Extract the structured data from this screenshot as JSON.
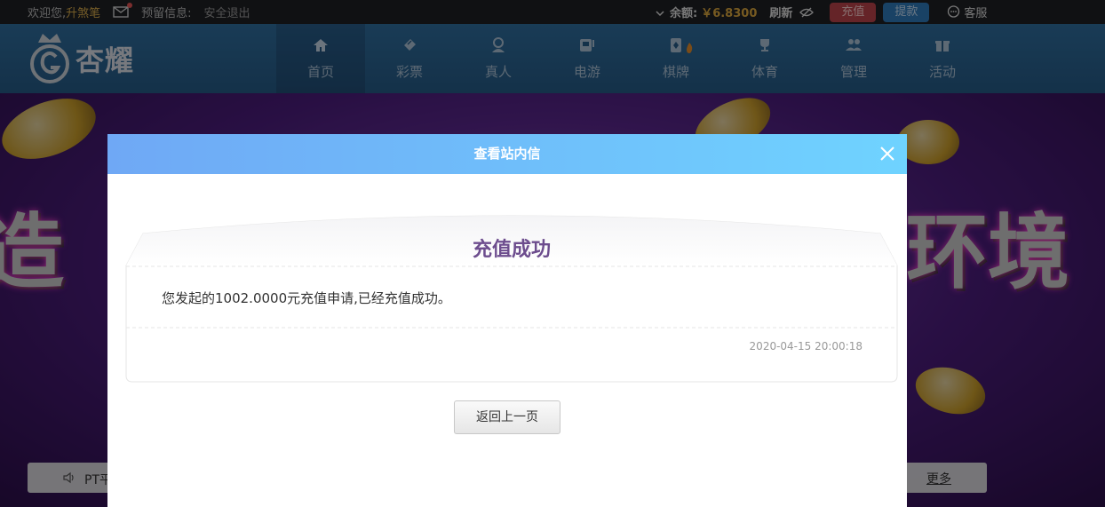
{
  "topbar": {
    "welcome": "欢迎您,",
    "username": "升煞笔",
    "reserve_label": "预留信息:",
    "logout": "安全退出",
    "balance_label": "余额:",
    "balance_value": "￥6.8300",
    "refresh": "刷新",
    "recharge": "充值",
    "withdraw": "提款",
    "service": "客服"
  },
  "logo": {
    "text": "杏耀"
  },
  "nav": {
    "items": [
      {
        "label": "首页",
        "icon": "home-icon"
      },
      {
        "label": "彩票",
        "icon": "lottery-icon"
      },
      {
        "label": "真人",
        "icon": "live-icon"
      },
      {
        "label": "电游",
        "icon": "slot-icon"
      },
      {
        "label": "棋牌",
        "icon": "chess-card-icon"
      },
      {
        "label": "体育",
        "icon": "trophy-icon"
      },
      {
        "label": "管理",
        "icon": "users-icon"
      },
      {
        "label": "活动",
        "icon": "gift-icon"
      }
    ]
  },
  "banner": {
    "headline_left": "造",
    "headline_right": "环境",
    "notice_text": "PT平",
    "more": "更多"
  },
  "modal": {
    "title": "查看站内信",
    "message_title": "充值成功",
    "message_body": "您发起的1002.0000元充值申请,已经充值成功。",
    "message_date": "2020-04-15 20:00:18",
    "back_button": "返回上一页"
  },
  "colors": {
    "accent_gold": "#d8a53d",
    "recharge_btn": "#b8434a",
    "withdraw_btn": "#2f78b8",
    "modal_header_start": "#6fa8f5",
    "modal_header_end": "#6fd3ff",
    "message_title": "#6d4d8e"
  }
}
